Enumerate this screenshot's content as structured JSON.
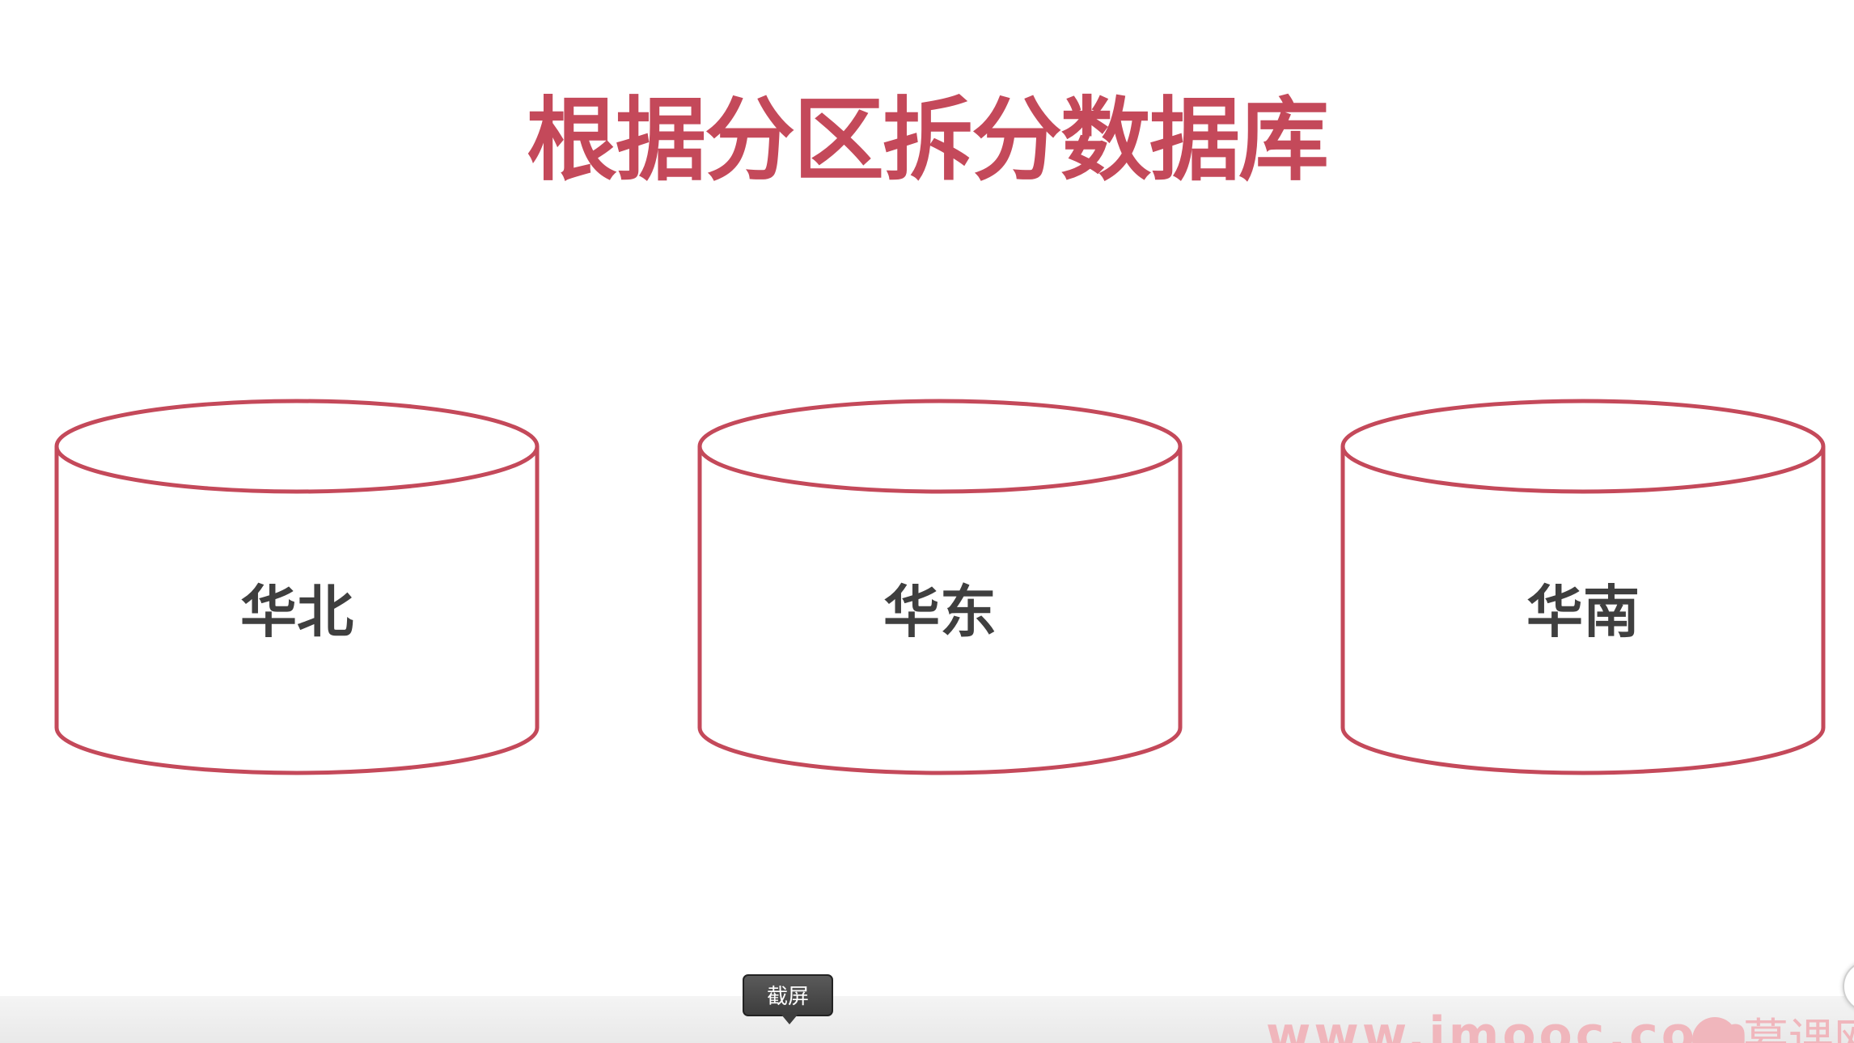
{
  "slide": {
    "title": "根据分区拆分数据库",
    "databases": [
      {
        "label": "华北"
      },
      {
        "label": "华东"
      },
      {
        "label": "华南"
      }
    ]
  },
  "overlay": {
    "tooltip": "截屏",
    "watermark_text": "www.imooc.com",
    "watermark_cn": "慕课网"
  },
  "colors": {
    "accent": "#c4495a",
    "label_text": "#3f3f3f",
    "watermark": "#f0b6bc"
  }
}
